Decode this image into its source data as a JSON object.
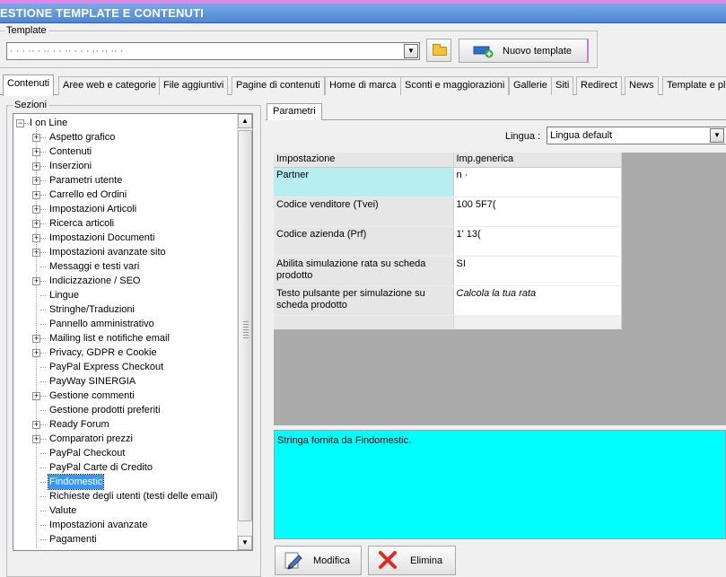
{
  "window": {
    "title": "ESTIONE TEMPLATE E CONTENUTI"
  },
  "template": {
    "group_label": "Template",
    "selected_value": "· · · ·· · ·· · · ·· · · · ·· ·· ·· ·",
    "new_button_label": "Nuovo template"
  },
  "tabs": [
    {
      "label": "Contenuti"
    },
    {
      "label": "Aree web e categorie"
    },
    {
      "label": "File aggiuntivi"
    },
    {
      "label": "Pagine di contenuti"
    },
    {
      "label": "Home di marca"
    },
    {
      "label": "Sconti e maggiorazioni"
    },
    {
      "label": "Gallerie"
    },
    {
      "label": "Siti"
    },
    {
      "label": "Redirect"
    },
    {
      "label": "News"
    },
    {
      "label": "Template e pl"
    }
  ],
  "sezioni": {
    "group_label": "Sezioni",
    "root": {
      "label": "I                    on Line"
    },
    "items": [
      {
        "label": "Aspetto grafico",
        "expandable": true
      },
      {
        "label": "Contenuti",
        "expandable": true
      },
      {
        "label": "Inserzioni",
        "expandable": true
      },
      {
        "label": "Parametri utente",
        "expandable": true
      },
      {
        "label": "Carrello ed Ordini",
        "expandable": true
      },
      {
        "label": "Impostazioni Articoli",
        "expandable": true
      },
      {
        "label": "Ricerca articoli",
        "expandable": true
      },
      {
        "label": "Impostazioni Documenti",
        "expandable": true
      },
      {
        "label": "Impostazioni avanzate sito",
        "expandable": true
      },
      {
        "label": "Messaggi e testi vari",
        "expandable": false
      },
      {
        "label": "Indicizzazione / SEO",
        "expandable": true
      },
      {
        "label": "Lingue",
        "expandable": false
      },
      {
        "label": "Stringhe/Traduzioni",
        "expandable": false
      },
      {
        "label": "Pannello amministrativo",
        "expandable": false
      },
      {
        "label": "Mailing list e notifiche email",
        "expandable": true
      },
      {
        "label": "Privacy, GDPR e Cookie",
        "expandable": true
      },
      {
        "label": "PayPal Express Checkout",
        "expandable": false
      },
      {
        "label": "PayWay SINERGIA",
        "expandable": false
      },
      {
        "label": "Gestione commenti",
        "expandable": true
      },
      {
        "label": "Gestione prodotti preferiti",
        "expandable": false
      },
      {
        "label": "Ready Forum",
        "expandable": true
      },
      {
        "label": "Comparatori prezzi",
        "expandable": true
      },
      {
        "label": "PayPal Checkout",
        "expandable": false
      },
      {
        "label": "PayPal Carte di Credito",
        "expandable": false
      },
      {
        "label": "Findomestic",
        "expandable": false,
        "selected": true
      },
      {
        "label": "Richieste degli utenti (testi delle email)",
        "expandable": false
      },
      {
        "label": "Valute",
        "expandable": false
      },
      {
        "label": "Impostazioni avanzate",
        "expandable": false
      },
      {
        "label": "Pagamenti",
        "expandable": false
      }
    ]
  },
  "parametri": {
    "tab_label": "Parametri",
    "lingua_label": "Lingua :",
    "lingua_value": "Lingua default",
    "grid": {
      "headers": [
        "Impostazione",
        "Imp.generica"
      ],
      "rows": [
        {
          "key": "Partner",
          "value": "n     ·",
          "italic": false
        },
        {
          "key": "Codice venditore (Tvei)",
          "value": "100      5F7(",
          "italic": false
        },
        {
          "key": "Codice azienda (Prf)",
          "value": "1' 13(",
          "italic": false
        },
        {
          "key": "Abilita simulazione rata su scheda prodotto",
          "value": "SI",
          "italic": false
        },
        {
          "key": "Testo pulsante per simulazione su scheda prodotto",
          "value": "Calcola la tua rata",
          "italic": true
        }
      ]
    },
    "description": "Stringa fornita da Findomestic.",
    "modify_label": "Modifica",
    "delete_label": "Elimina"
  },
  "colors": {
    "titlebar": "#4f86d4",
    "highlight_key": "#b7eef0",
    "description_bg": "#00ffff",
    "selection": "#3399ff",
    "delete_icon": "#e02a1f"
  }
}
